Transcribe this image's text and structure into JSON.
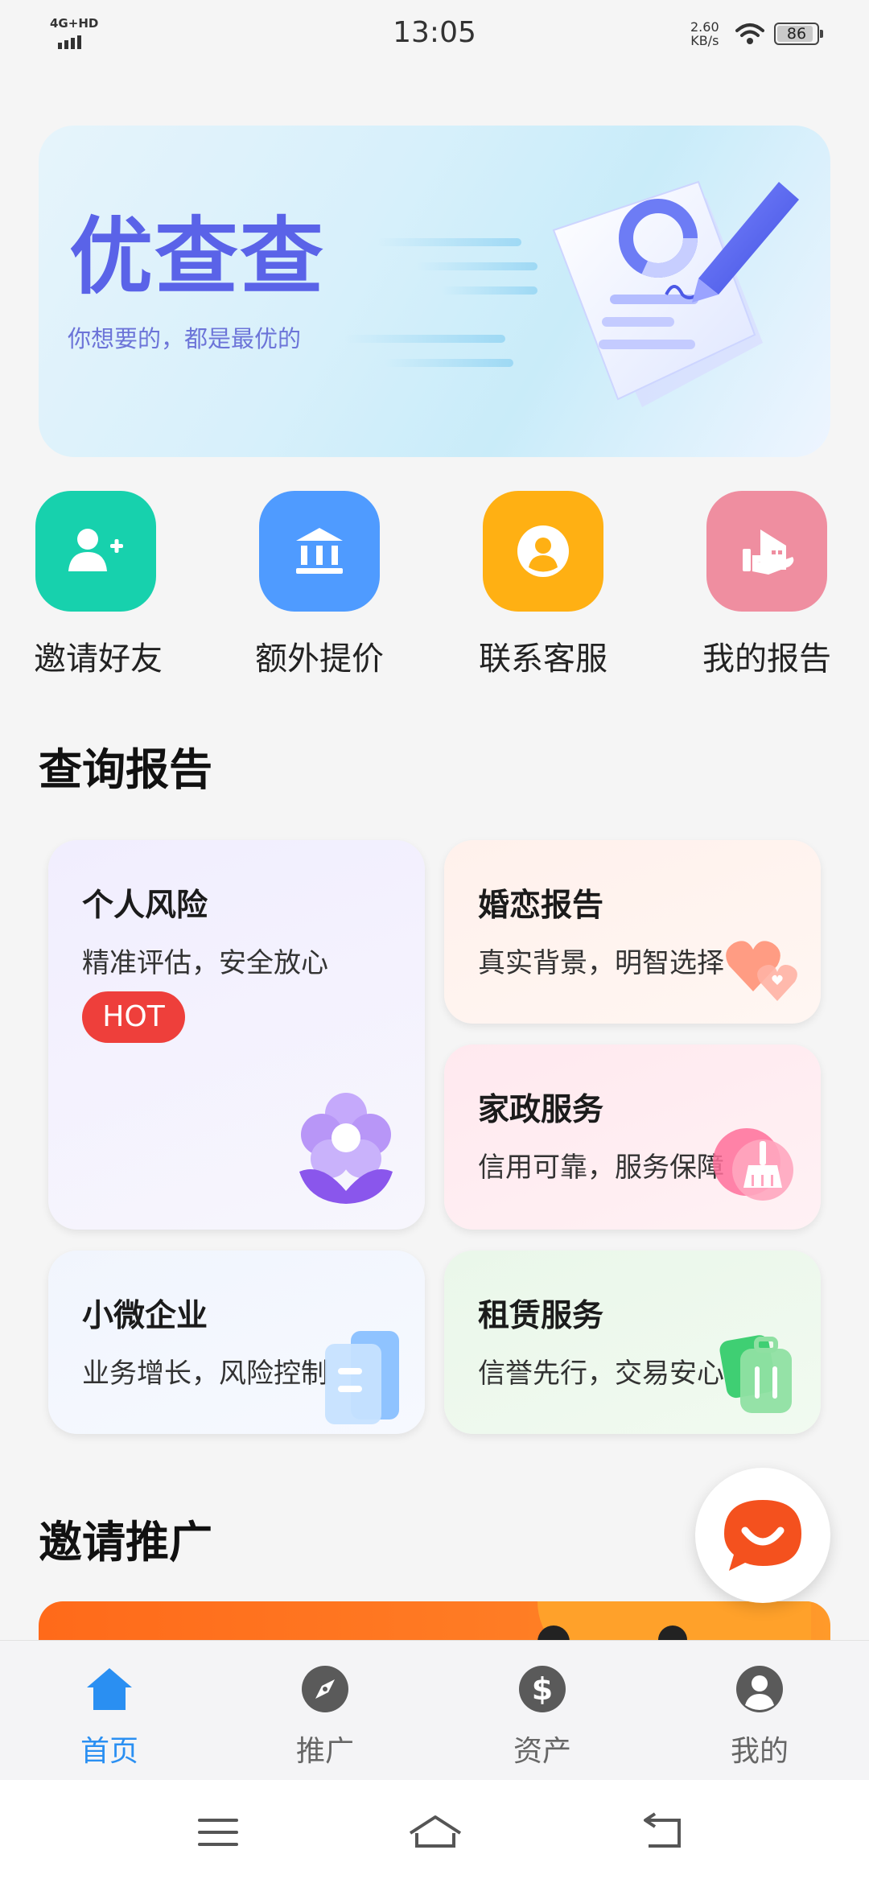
{
  "status_bar": {
    "network": "4G+HD",
    "time": "13:05",
    "speed_value": "2.60",
    "speed_unit": "KB/s",
    "battery": "86"
  },
  "banner": {
    "logo_text": "优查查",
    "tagline": "你想要的，都是最优的"
  },
  "quick_actions": [
    {
      "label": "邀请好友",
      "icon": "add-user-icon",
      "color": "#17d1ad"
    },
    {
      "label": "额外提价",
      "icon": "bank-icon",
      "color": "#4f9bff"
    },
    {
      "label": "联系客服",
      "icon": "person-circle-icon",
      "color": "#ffb013"
    },
    {
      "label": "我的报告",
      "icon": "house-hand-icon",
      "color": "#ef8ea0"
    }
  ],
  "sections": {
    "query_title": "查询报告",
    "invite_title": "邀请推广"
  },
  "cards": {
    "personal": {
      "title": "个人风险",
      "subtitle": "精准评估，安全放心",
      "badge": "HOT"
    },
    "marriage": {
      "title": "婚恋报告",
      "subtitle": "真实背景，明智选择"
    },
    "housekeeping": {
      "title": "家政服务",
      "subtitle": "信用可靠，服务保障"
    },
    "business": {
      "title": "小微企业",
      "subtitle": "业务增长，风险控制"
    },
    "rental": {
      "title": "租赁服务",
      "subtitle": "信誉先行，交易安心"
    }
  },
  "tabbar": [
    {
      "label": "首页",
      "icon": "home-icon",
      "active": true
    },
    {
      "label": "推广",
      "icon": "compass-icon",
      "active": false
    },
    {
      "label": "资产",
      "icon": "dollar-icon",
      "active": false
    },
    {
      "label": "我的",
      "icon": "profile-icon",
      "active": false
    }
  ],
  "colors": {
    "accent": "#2a8ff2",
    "hot": "#ee3f3b",
    "logo": "#5a63e8"
  }
}
